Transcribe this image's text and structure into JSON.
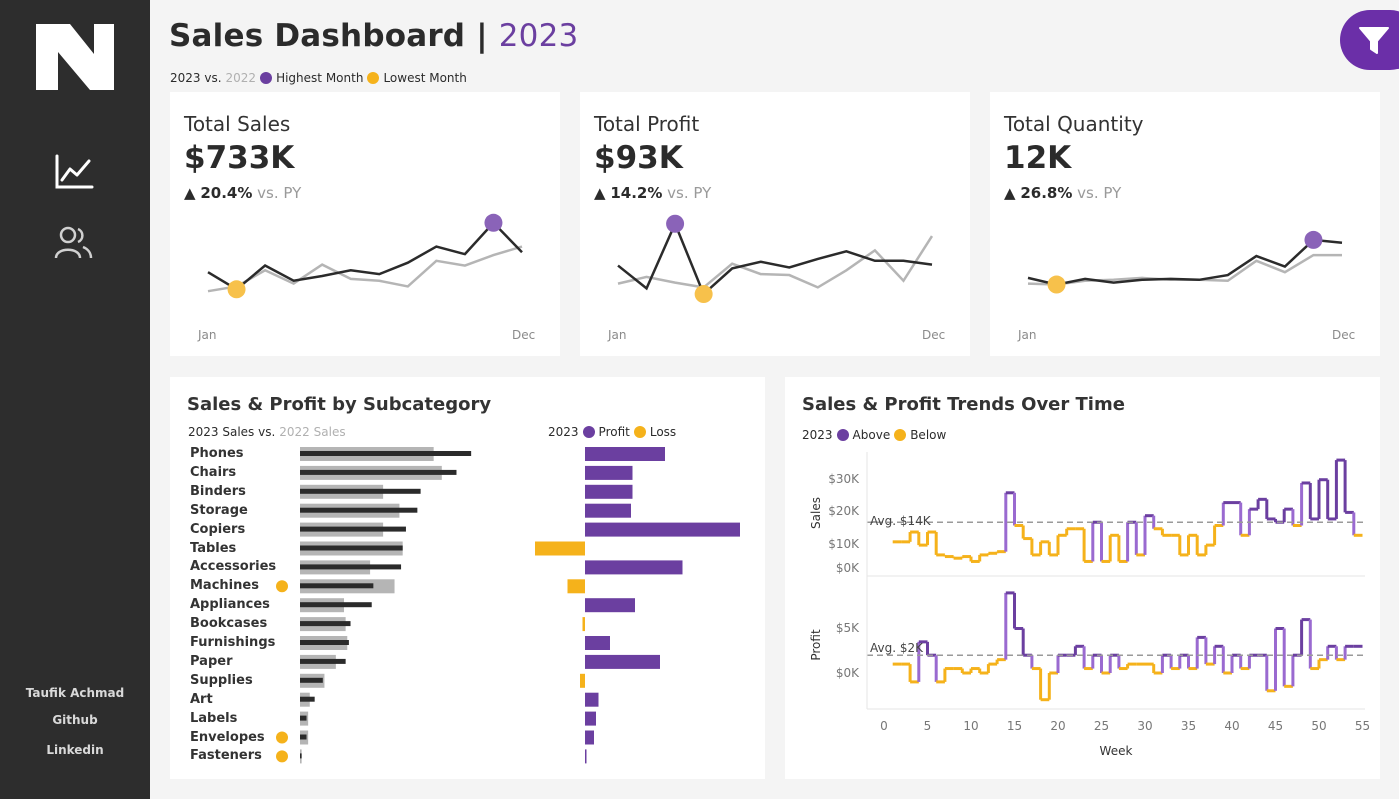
{
  "sidebar": {
    "author": "Taufik Achmad",
    "links": [
      "Github",
      "Linkedin"
    ]
  },
  "header": {
    "title": "Sales Dashboard |",
    "year": "2023",
    "legend_2023": "2023 vs.",
    "legend_2022": "2022",
    "legend_high": "Highest Month",
    "legend_low": "Lowest Month"
  },
  "colors": {
    "purple": "#6b3fa0",
    "yellow": "#f5b21b",
    "dark": "#2b2b2b",
    "grey": "#b5b5b5"
  },
  "kpis": [
    {
      "title": "Total Sales",
      "value": "$733K",
      "delta": "20.4%",
      "vs": "vs. PY",
      "x_start": "Jan",
      "x_end": "Dec",
      "cy": [
        44,
        26,
        51,
        35,
        40,
        46,
        42,
        54,
        71,
        63,
        96,
        65
      ],
      "py": [
        24,
        29,
        46,
        32,
        52,
        37,
        35,
        29,
        56,
        51,
        62,
        71
      ],
      "max_index": 10,
      "min_index": 1
    },
    {
      "title": "Total Profit",
      "value": "$93K",
      "delta": "14.2%",
      "vs": "vs. PY",
      "x_start": "Jan",
      "x_end": "Dec",
      "cy": [
        51,
        27,
        95,
        21,
        48,
        55,
        49,
        58,
        66,
        56,
        56,
        52
      ],
      "py": [
        32,
        39,
        33,
        28,
        53,
        42,
        41,
        28,
        46,
        67,
        35,
        82
      ],
      "max_index": 2,
      "min_index": 3
    },
    {
      "title": "Total Quantity",
      "value": "12K",
      "delta": "26.8%",
      "vs": "vs. PY",
      "x_start": "Jan",
      "x_end": "Dec",
      "cy": [
        38,
        31,
        37,
        33,
        36,
        37,
        36,
        41,
        61,
        50,
        78,
        75
      ],
      "py": [
        32,
        31,
        35,
        36,
        38,
        36,
        36,
        35,
        56,
        44,
        62,
        62
      ],
      "max_index": 10,
      "min_index": 1
    }
  ],
  "subcategory": {
    "title": "Sales & Profit by Subcategory",
    "sales_legend_2023": "2023 Sales vs.",
    "sales_legend_2022": "2022 Sales",
    "profit_legend_year": "2023",
    "profit_legend_profit": "Profit",
    "profit_legend_loss": "Loss",
    "chart_data": {
      "type": "bar",
      "categories": [
        "Phones",
        "Chairs",
        "Binders",
        "Storage",
        "Copiers",
        "Tables",
        "Accessories",
        "Machines",
        "Appliances",
        "Bookcases",
        "Furnishings",
        "Paper",
        "Supplies",
        "Art",
        "Labels",
        "Envelopes",
        "Fasteners"
      ],
      "series": [
        {
          "name": "2023 Sales",
          "values": [
            105,
            96,
            74,
            72,
            65,
            63,
            62,
            45,
            44,
            31,
            30,
            28,
            14,
            9,
            4,
            4,
            1
          ]
        },
        {
          "name": "2022 Sales",
          "values": [
            82,
            87,
            51,
            61,
            51,
            63,
            43,
            58,
            27,
            28,
            29,
            22,
            15,
            6,
            5,
            5,
            1
          ]
        },
        {
          "name": "Profit",
          "values": [
            16,
            9.5,
            9.5,
            9.2,
            31,
            -10,
            19.5,
            -3.5,
            10,
            -0.5,
            5,
            15,
            -1,
            2.7,
            2.2,
            1.8,
            0.3
          ]
        }
      ],
      "loss_flags": [
        false,
        false,
        false,
        false,
        false,
        false,
        false,
        true,
        false,
        false,
        false,
        false,
        false,
        false,
        false,
        true,
        true
      ]
    }
  },
  "trends": {
    "title": "Sales & Profit Trends Over Time",
    "legend_year": "2023",
    "legend_above": "Above",
    "legend_below": "Below",
    "sales_ylabel": "Sales",
    "profit_ylabel": "Profit",
    "xlabel": "Week",
    "sales_avg_label": "Avg. $14K",
    "profit_avg_label": "Avg. $2K",
    "sales_ticks": [
      "$30K",
      "$20K",
      "$10K",
      "$0K"
    ],
    "profit_ticks": [
      "$5K",
      "$0K"
    ],
    "x_ticks": [
      "0",
      "5",
      "10",
      "15",
      "20",
      "25",
      "30",
      "35",
      "40",
      "45",
      "50",
      "55"
    ],
    "chart_data": {
      "type": "line",
      "x_label": "Week",
      "sales_avg": 14,
      "profit_avg": 2,
      "sales": [
        8,
        8,
        11,
        7,
        11,
        4,
        3.5,
        3,
        3.5,
        2,
        4,
        4.5,
        5,
        23,
        13,
        9,
        4,
        8,
        4,
        10,
        12,
        12,
        2,
        14,
        2,
        10,
        2,
        14,
        4,
        16,
        12,
        10,
        10,
        4,
        10,
        4,
        7,
        13,
        20,
        20,
        10,
        18,
        21,
        15,
        14,
        18,
        13,
        26,
        15,
        27,
        15,
        33,
        17,
        10
      ],
      "profit": [
        1,
        1,
        -1,
        3.5,
        2,
        -1,
        0.5,
        0.5,
        0,
        0.5,
        0,
        1,
        1.5,
        9,
        5,
        2,
        0.5,
        -3,
        0,
        2,
        2,
        3,
        0.5,
        2,
        0,
        2,
        0.5,
        1,
        1,
        1,
        0,
        2,
        0.5,
        2,
        0.5,
        4,
        1,
        3,
        0,
        2,
        0.5,
        2,
        2,
        -2,
        5,
        -1.5,
        2,
        6,
        0.5,
        1.5,
        3,
        1.5,
        3,
        3
      ]
    }
  }
}
